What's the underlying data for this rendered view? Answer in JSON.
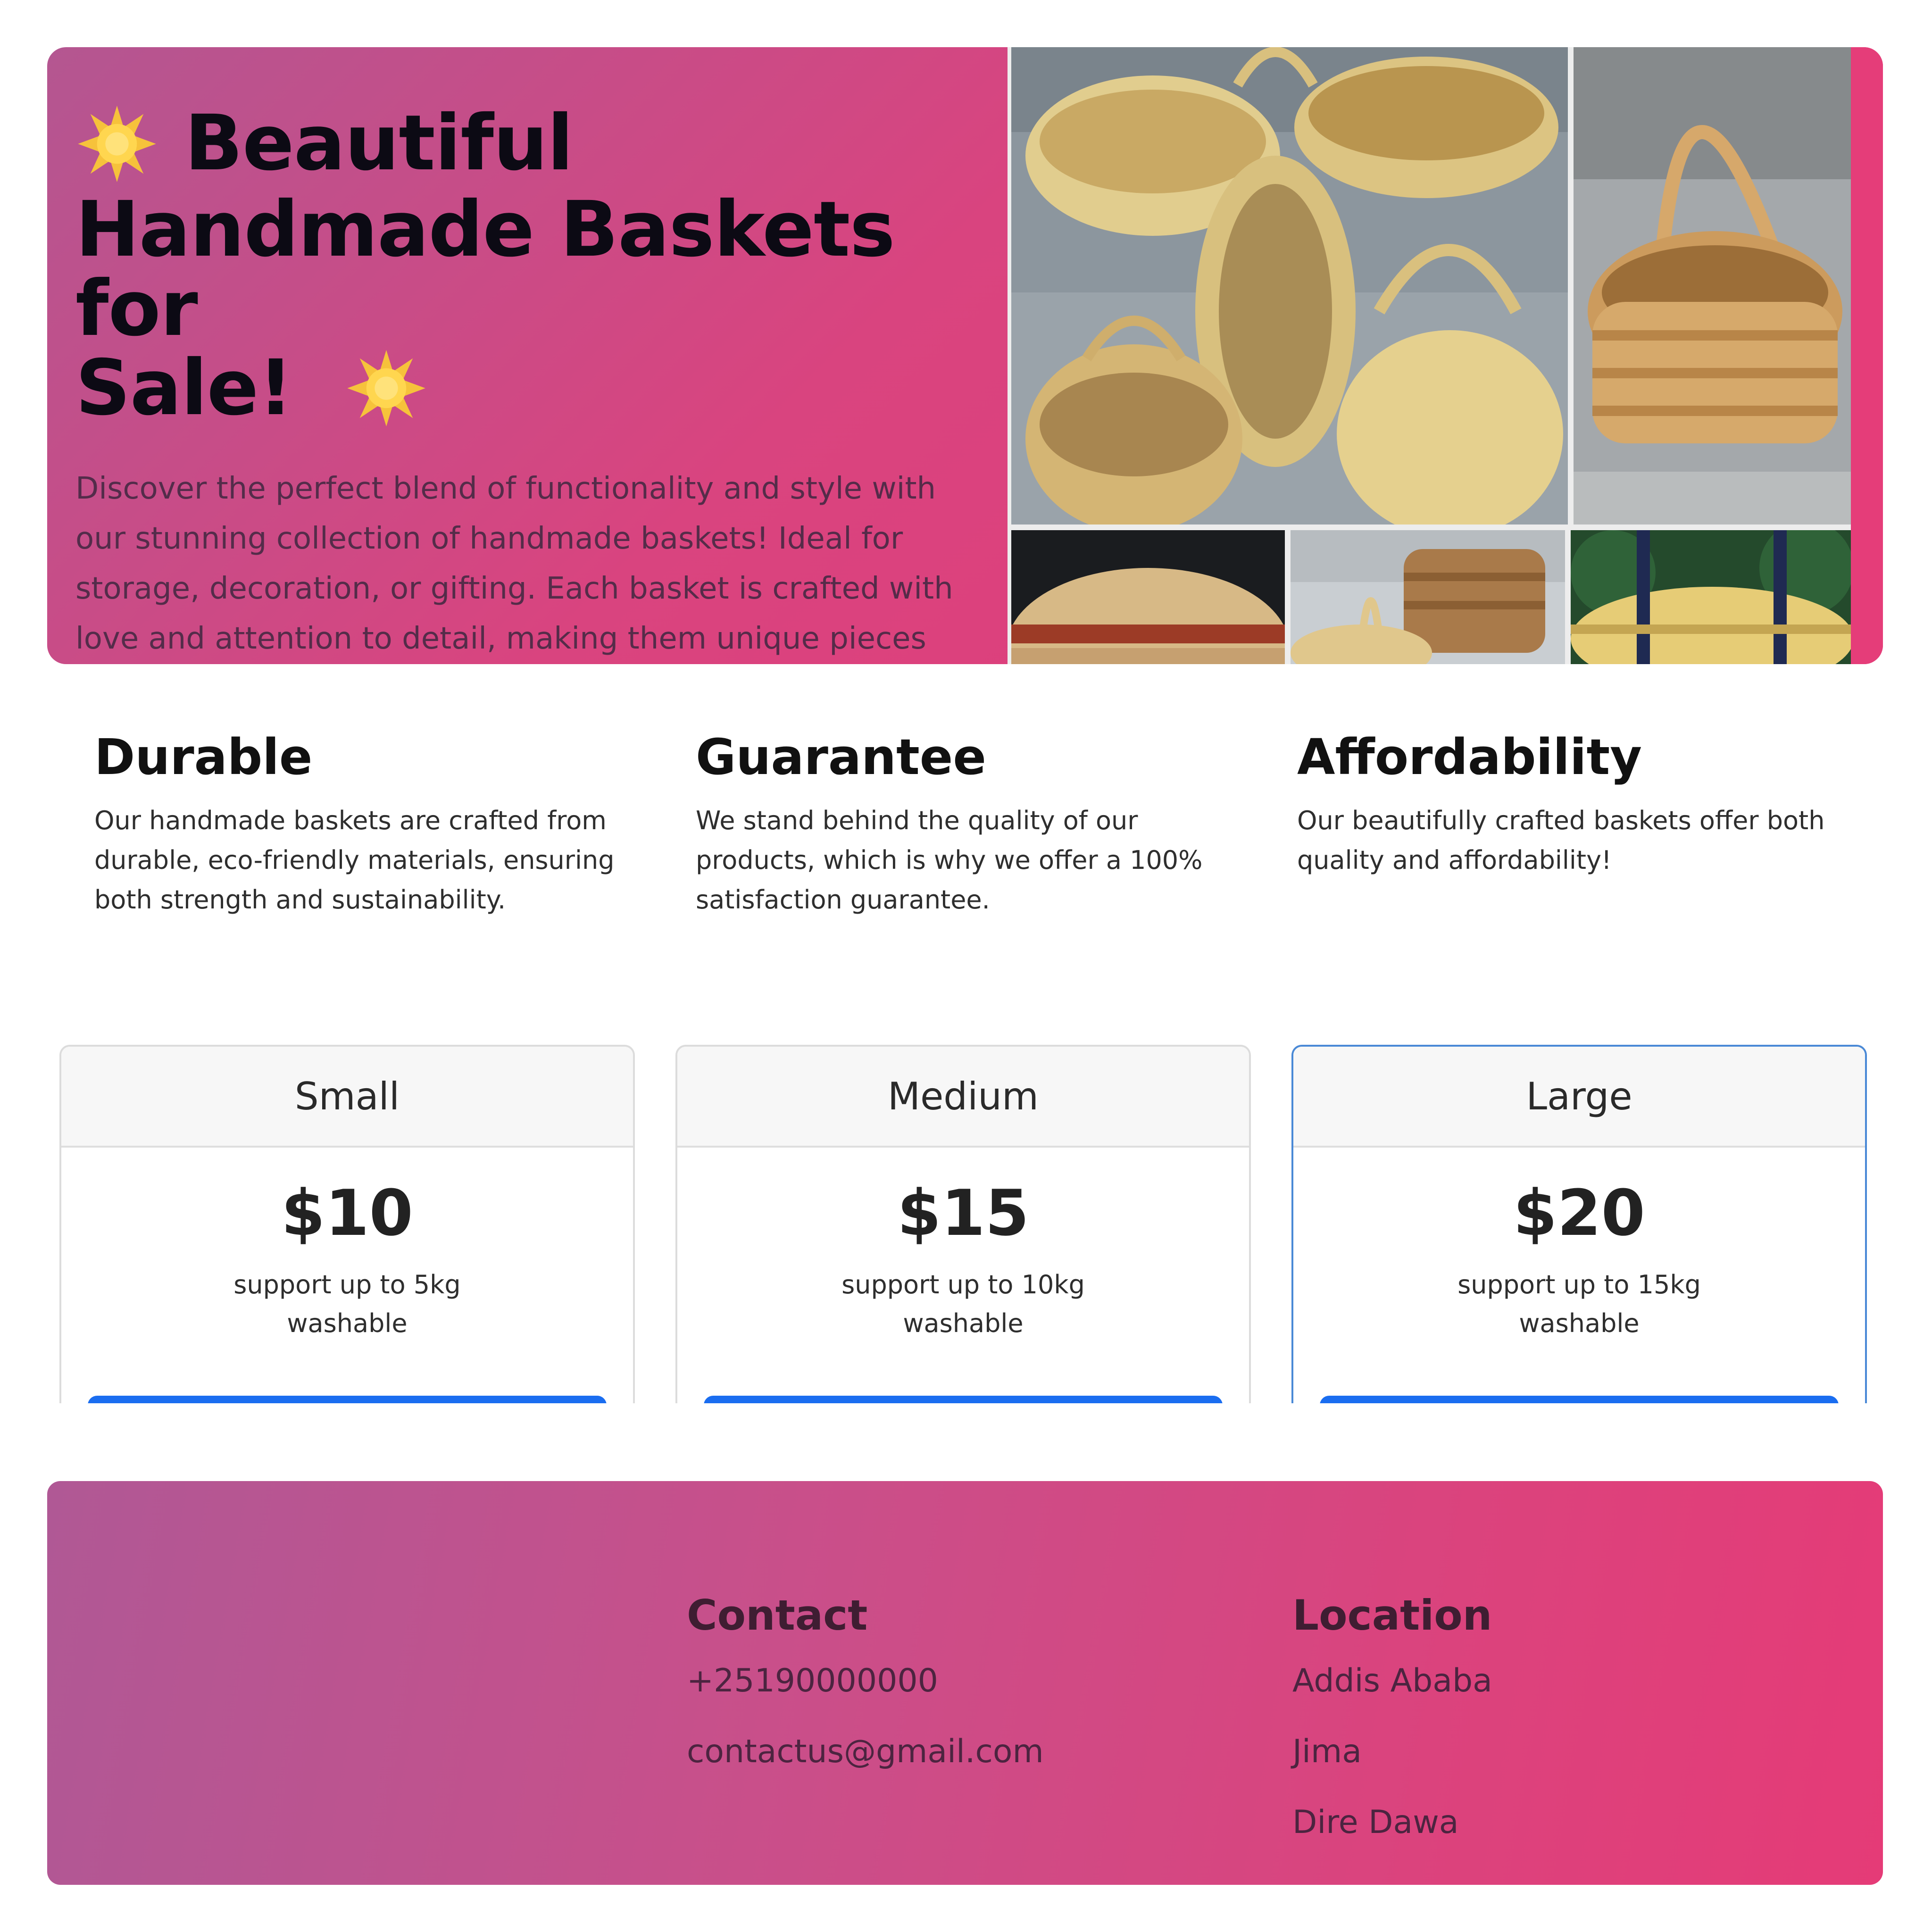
{
  "hero": {
    "title": "Beautiful Handmade Baskets for Sale!",
    "title_part1": "Beautiful",
    "title_part2": "Handmade Baskets for",
    "title_part3": "Sale!",
    "description": "Discover the perfect blend of functionality and style with our stunning collection of handmade baskets! Ideal for storage, decoration, or gifting. Each basket is crafted with love and attention to detail, making them unique pieces for your home.",
    "icon": "sparkle-icon",
    "colors": {
      "gradient_start": "#b45691",
      "gradient_end": "#e33a78"
    }
  },
  "features": [
    {
      "title": "Durable",
      "text": "Our handmade baskets are crafted from durable, eco-friendly materials, ensuring both strength and sustainability."
    },
    {
      "title": "Guarantee",
      "text": "We stand behind the quality of our products, which is why we offer a 100% satisfaction guarantee."
    },
    {
      "title": "Affordability",
      "text": "Our beautifully crafted baskets offer both quality and affordability!"
    }
  ],
  "pricing": [
    {
      "name": "Small",
      "price": "$10",
      "features": [
        "support up to 5kg",
        "washable"
      ]
    },
    {
      "name": "Medium",
      "price": "$15",
      "features": [
        "support up to 10kg",
        "washable"
      ]
    },
    {
      "name": "Large",
      "price": "$20",
      "features": [
        "support up to 15kg",
        "washable"
      ]
    }
  ],
  "footer": {
    "contact": {
      "heading": "Contact",
      "phone": "+25190000000",
      "email": "contactus@gmail.com"
    },
    "location": {
      "heading": "Location",
      "cities": [
        "Addis Ababa",
        "Jima",
        "Dire Dawa"
      ]
    }
  },
  "colors": {
    "accent": "#1a6df0",
    "featured_border": "#4a89d6"
  }
}
